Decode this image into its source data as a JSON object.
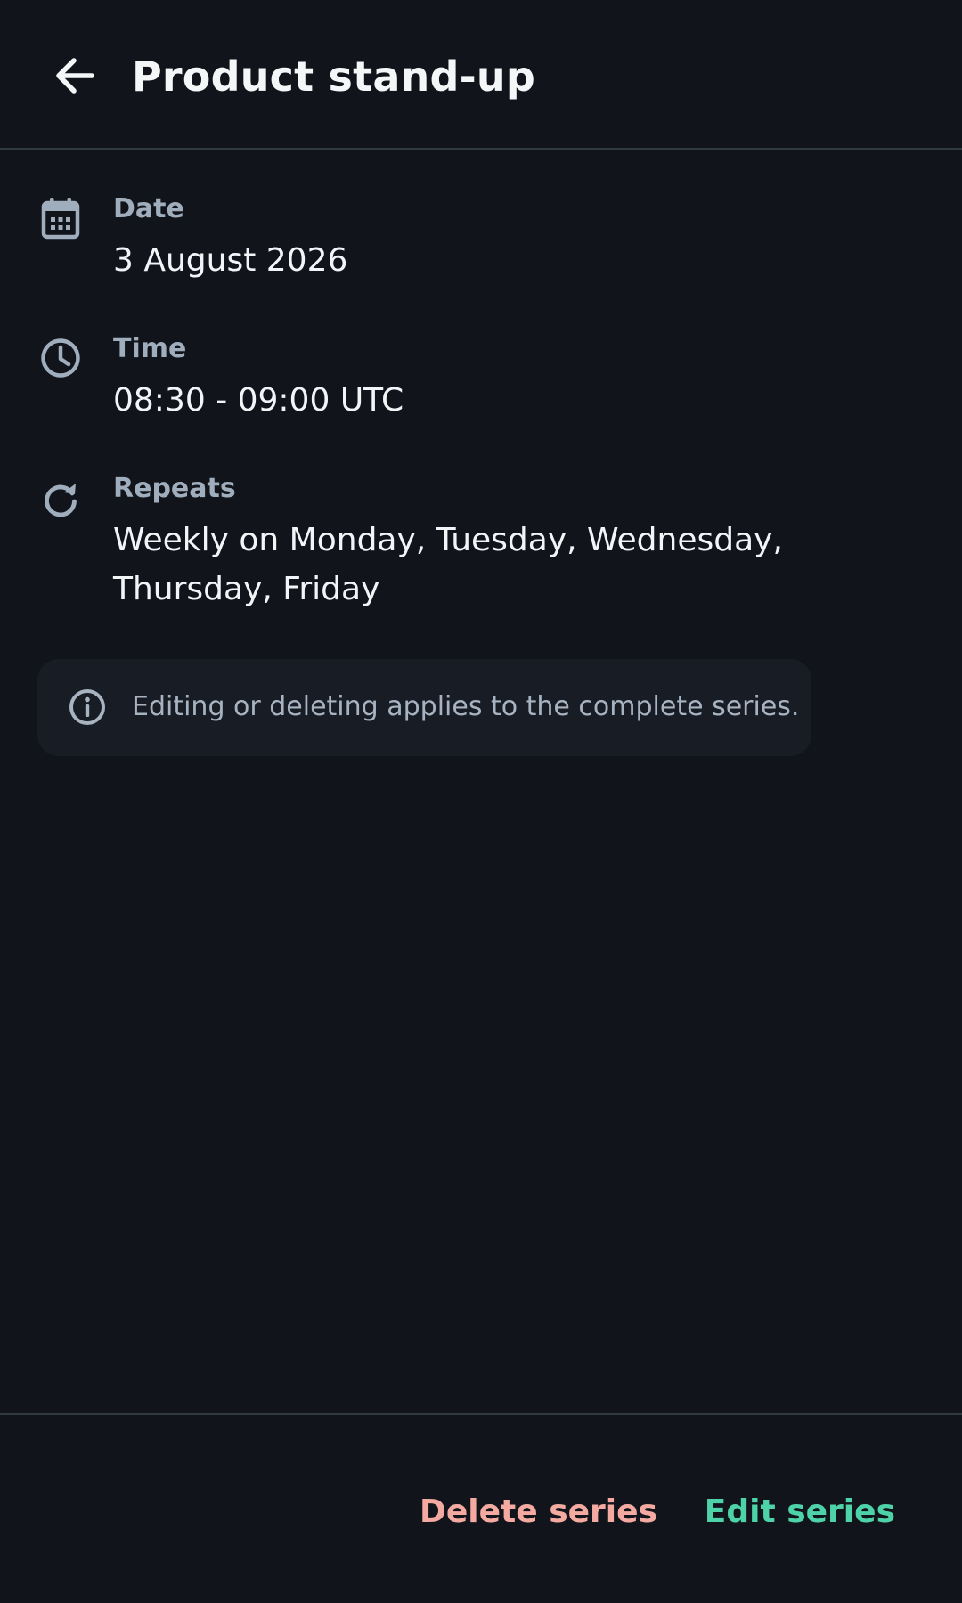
{
  "header": {
    "title": "Product stand-up",
    "back_icon": "arrow-left-icon"
  },
  "details": {
    "date": {
      "label": "Date",
      "value": "3 August 2026",
      "icon": "calendar-icon"
    },
    "time": {
      "label": "Time",
      "value": "08:30 - 09:00 UTC",
      "icon": "clock-icon"
    },
    "repeats": {
      "label": "Repeats",
      "value": "Weekly on Monday, Tuesday, Wednesday, Thursday, Friday",
      "icon": "refresh-icon"
    }
  },
  "info": {
    "text": "Editing or deleting applies to the complete series.",
    "icon": "info-icon"
  },
  "footer": {
    "delete_label": "Delete series",
    "edit_label": "Edit series"
  },
  "colors": {
    "background": "#11141a",
    "accent": "#4ed3a8",
    "danger": "#f4aaa1",
    "muted": "#9fadbd"
  }
}
